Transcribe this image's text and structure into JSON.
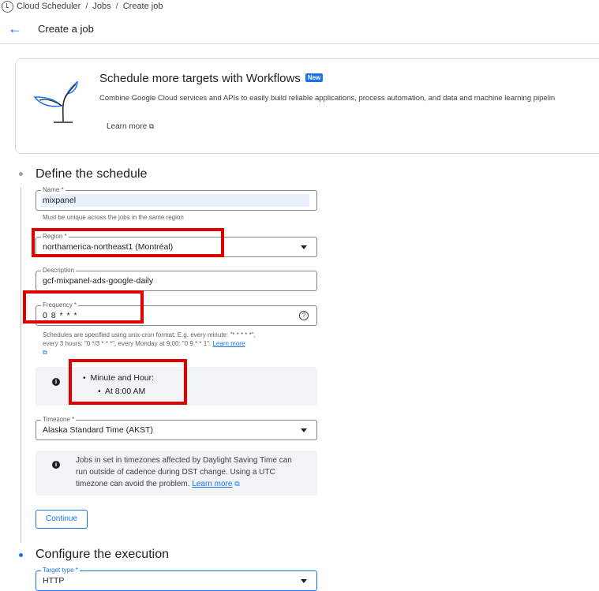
{
  "breadcrumb": {
    "items": [
      "Cloud Scheduler",
      "Jobs",
      "Create job"
    ],
    "sep": "/"
  },
  "header": {
    "back_icon": "←",
    "title": "Create a job"
  },
  "promo": {
    "title": "Schedule more targets with Workflows",
    "badge": "New",
    "description": "Combine Google Cloud services and APIs to easily build reliable applications, process automation, and data and machine learning pipelin",
    "learn_more": "Learn more",
    "external_icon": "⧉"
  },
  "step1": {
    "title": "Define the schedule",
    "name": {
      "label": "Name *",
      "value": "mixpanel",
      "hint": "Must be unique across the jobs in the same region"
    },
    "region": {
      "label": "Region *",
      "value": "northamerica-northeast1 (Montréal)"
    },
    "description": {
      "label": "Description",
      "value": "gcf-mixpanel-ads-google-daily"
    },
    "frequency": {
      "label": "Frequency *",
      "value": "0 8 * * *",
      "help_icon": "?",
      "hint_line1": "Schedules are specified using unix-cron format. E.g. every minute: \"* * * * *\",",
      "hint_line2": "every 3 hours: \"0 */3 * * *\", every Monday at 9:00: \"0 9 * * 1\".",
      "hint_link": "Learn more",
      "hint_icon": "⧉"
    },
    "freq_info": {
      "icon": "i",
      "bullet": "Minute and Hour:",
      "sub_bullet": "At 8:00 AM"
    },
    "timezone": {
      "label": "Timezone *",
      "value": "Alaska Standard Time (AKST)"
    },
    "dst_info": {
      "icon": "i",
      "line1": "Jobs in set in timezones affected by Daylight Saving Time can",
      "line2": "run outside of cadence during DST change. Using a UTC",
      "line3": "timezone can avoid the problem.",
      "link": "Learn more",
      "link_icon": "⧉"
    },
    "continue_label": "Continue"
  },
  "step2": {
    "title": "Configure the execution",
    "target_type": {
      "label": "Target type *",
      "value": "HTTP"
    }
  },
  "colors": {
    "accent": "#1a73e8",
    "highlight": "#e00000"
  }
}
